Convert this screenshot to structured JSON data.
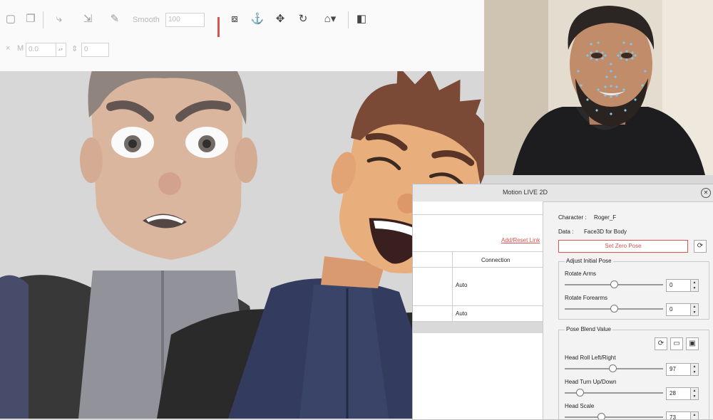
{
  "toolbar": {
    "row1": {
      "smooth_label": "Smooth",
      "smooth_value": "100"
    },
    "row2": {
      "field_a_label": "M",
      "field_a_value": "0.0",
      "field_b_value": "0"
    }
  },
  "panel": {
    "title": "Motion LIVE 2D",
    "close_glyph": "✕",
    "character_label": "Character :",
    "character_value": "Roger_F",
    "data_label": "Data :",
    "data_value": "Face3D for Body",
    "set_zero_pose": "Set Zero Pose",
    "reset_glyph": "⟳",
    "adjust_initial_pose": {
      "title": "Adjust Initial Pose",
      "rotate_arms_label": "Rotate Arms",
      "rotate_arms_value": "0",
      "rotate_forearms_label": "Rotate Forearms",
      "rotate_forearms_value": "0"
    },
    "pose_blend": {
      "title": "Pose Blend Value",
      "head_roll_label": "Head Roll Left/Right",
      "head_roll_value": "97",
      "head_turn_label": "Head Turn Up/Down",
      "head_turn_value": "28",
      "head_scale_label": "Head Scale",
      "head_scale_value": "73"
    },
    "left_table": {
      "add_link": "Add/Reset Link",
      "connection_header": "Connection",
      "rows": [
        {
          "connection": "Auto"
        },
        {
          "connection": "Auto"
        }
      ]
    }
  },
  "colors": {
    "accent_red": "#d9534f",
    "panel_bg": "#f3f3f3",
    "stage_bg": "#d7d7d7"
  }
}
